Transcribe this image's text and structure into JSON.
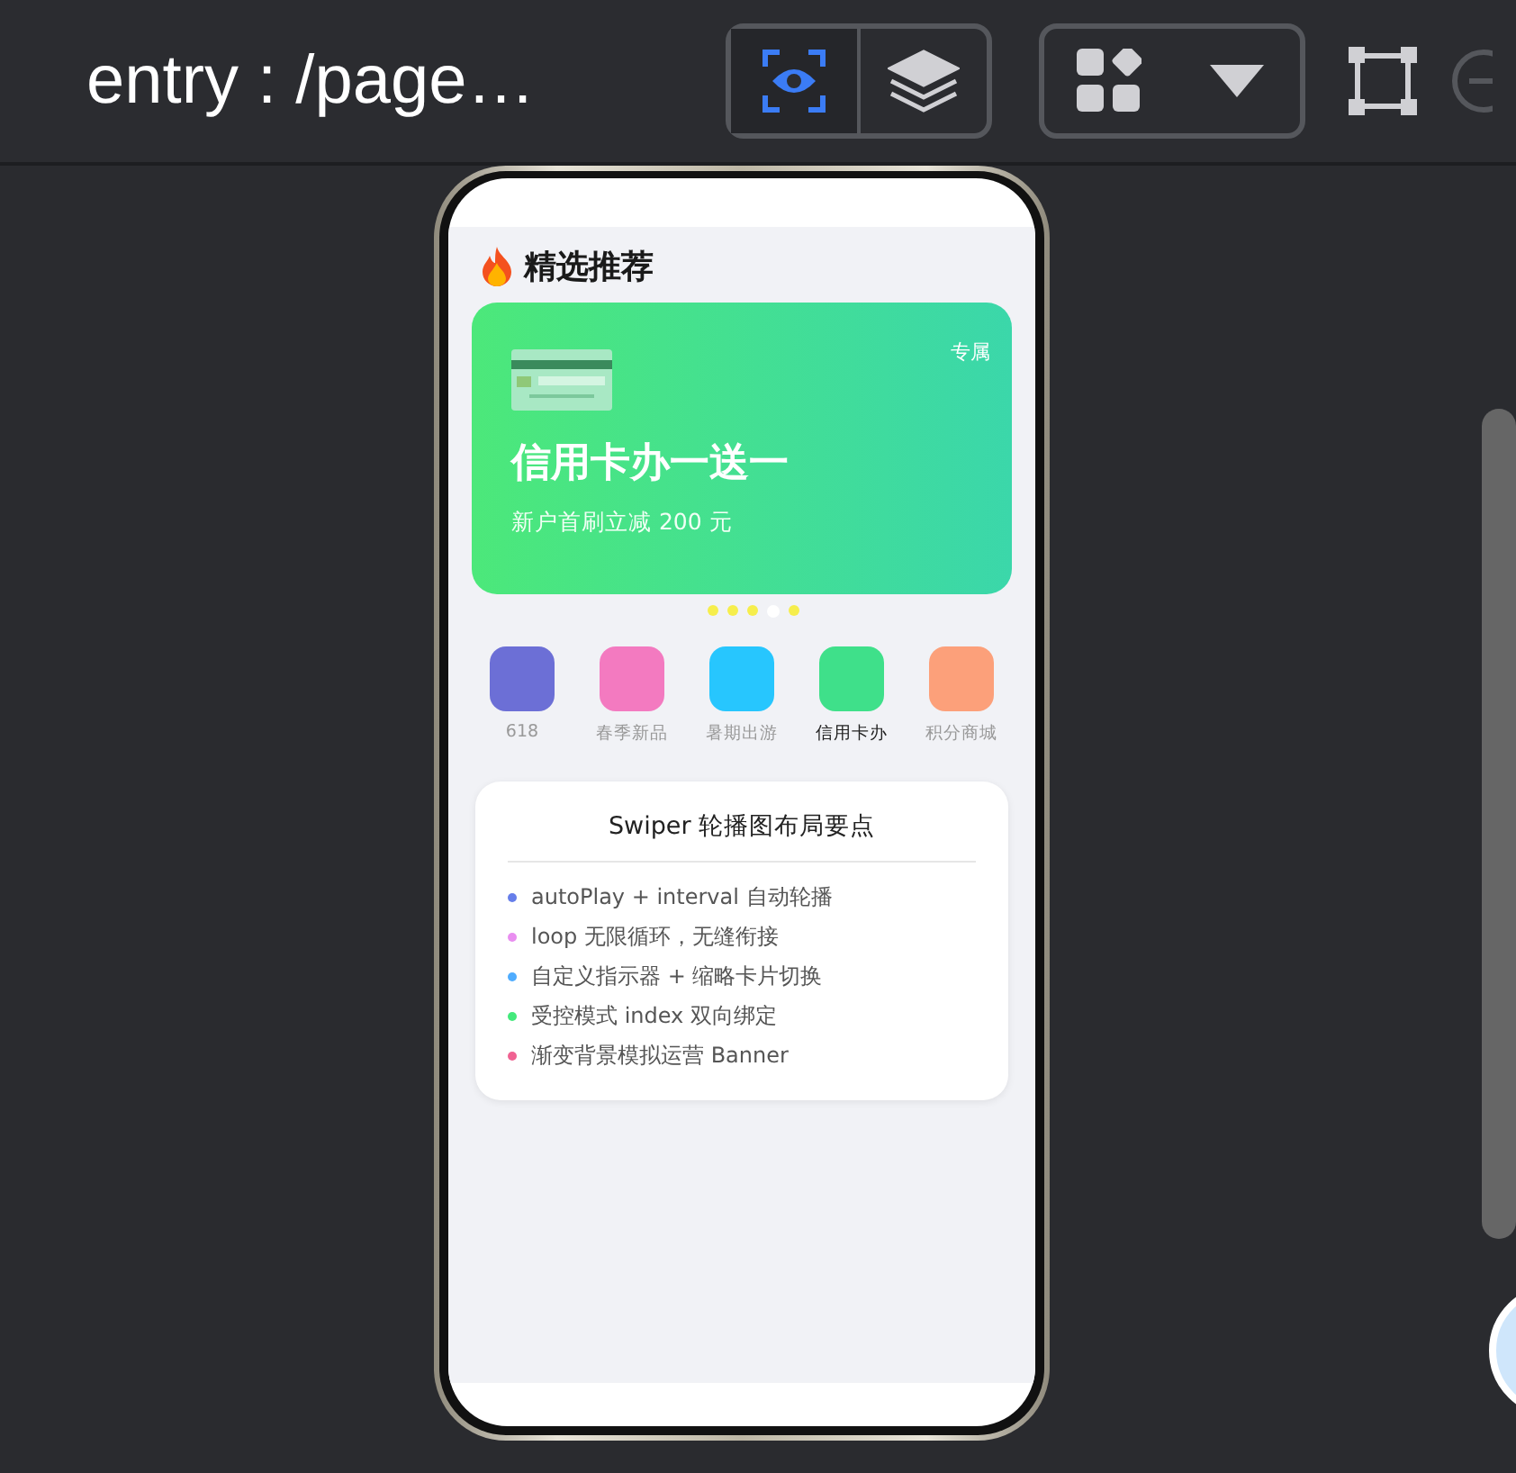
{
  "toolbar": {
    "title": "entry : /page…",
    "view_buttons": [
      {
        "kind": "eye",
        "selected": true
      },
      {
        "kind": "layers",
        "selected": false
      }
    ]
  },
  "phone": {
    "section_title": "精选推荐",
    "banner": {
      "tag": "专属",
      "title": "信用卡办一送一",
      "subtitle": "新户首刷立减 200 元"
    },
    "indicator": [
      {
        "selected": false
      },
      {
        "selected": false
      },
      {
        "selected": false
      },
      {
        "selected": true
      },
      {
        "selected": false
      }
    ],
    "categories": [
      {
        "label": "618",
        "color": "#6c6fd6",
        "selected": false
      },
      {
        "label": "春季新品",
        "color": "#f37ac0",
        "selected": false
      },
      {
        "label": "暑期出游",
        "color": "#27c6fe",
        "selected": false
      },
      {
        "label": "信用卡办",
        "color": "#3fe08a",
        "selected": true
      },
      {
        "label": "积分商城",
        "color": "#fca07a",
        "selected": false
      }
    ],
    "notes": {
      "title": "Swiper 轮播图布局要点",
      "items": [
        {
          "text": "autoPlay + interval 自动轮播",
          "color": "#667eea"
        },
        {
          "text": "loop 无限循环，无缝衔接",
          "color": "#e98ef0"
        },
        {
          "text": "自定义指示器 + 缩略卡片切换",
          "color": "#4facfe"
        },
        {
          "text": "受控模式 index 双向绑定",
          "color": "#43e97b"
        },
        {
          "text": "渐变背景模拟运营 Banner",
          "color": "#f06292"
        }
      ]
    }
  }
}
